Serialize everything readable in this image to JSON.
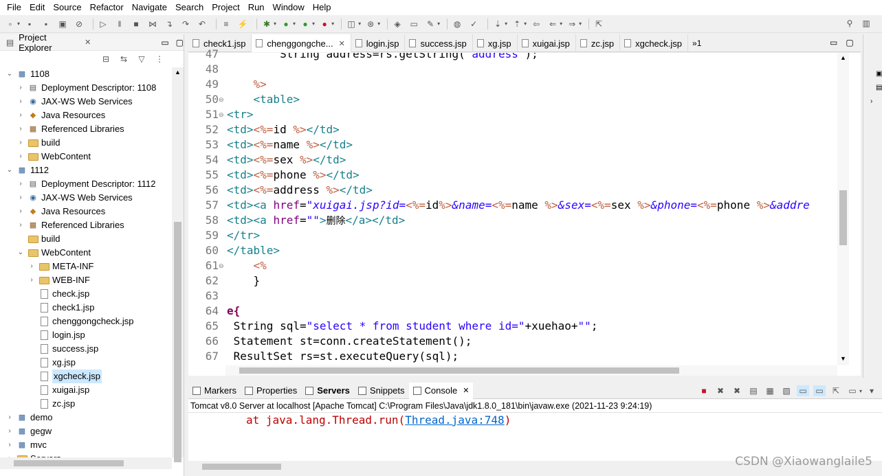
{
  "menu": [
    "File",
    "Edit",
    "Source",
    "Refactor",
    "Navigate",
    "Search",
    "Project",
    "Run",
    "Window",
    "Help"
  ],
  "explorer": {
    "title": "Project Explorer",
    "close": "✕",
    "tree": [
      {
        "label": "1108",
        "twisty": "⌄",
        "icon": "project-icon"
      },
      {
        "label": "Deployment Descriptor: 1108",
        "twisty": "›",
        "icon": "descriptor-icon"
      },
      {
        "label": "JAX-WS Web Services",
        "twisty": "›",
        "icon": "webservice-icon"
      },
      {
        "label": "Java Resources",
        "twisty": "›",
        "icon": "java-resources-icon"
      },
      {
        "label": "Referenced Libraries",
        "twisty": "›",
        "icon": "library-icon"
      },
      {
        "label": "build",
        "twisty": "›",
        "icon": "folder-icon"
      },
      {
        "label": "WebContent",
        "twisty": "›",
        "icon": "folder-icon"
      },
      {
        "label": "1112",
        "twisty": "⌄",
        "icon": "project-icon"
      },
      {
        "label": "Deployment Descriptor: 1112",
        "twisty": "›",
        "icon": "descriptor-icon"
      },
      {
        "label": "JAX-WS Web Services",
        "twisty": "›",
        "icon": "webservice-icon"
      },
      {
        "label": "Java Resources",
        "twisty": "›",
        "icon": "java-resources-icon"
      },
      {
        "label": "Referenced Libraries",
        "twisty": "›",
        "icon": "library-icon"
      },
      {
        "label": "build",
        "twisty": "",
        "icon": "folder-icon"
      },
      {
        "label": "WebContent",
        "twisty": "⌄",
        "icon": "folder-icon"
      },
      {
        "label": "META-INF",
        "twisty": "›",
        "icon": "folder-icon"
      },
      {
        "label": "WEB-INF",
        "twisty": "›",
        "icon": "folder-icon"
      },
      {
        "label": "check.jsp",
        "twisty": "",
        "icon": "file-icon"
      },
      {
        "label": "check1.jsp",
        "twisty": "",
        "icon": "file-icon"
      },
      {
        "label": "chenggongcheck.jsp",
        "twisty": "",
        "icon": "file-icon"
      },
      {
        "label": "login.jsp",
        "twisty": "",
        "icon": "file-icon"
      },
      {
        "label": "success.jsp",
        "twisty": "",
        "icon": "file-icon"
      },
      {
        "label": "xg.jsp",
        "twisty": "",
        "icon": "file-icon"
      },
      {
        "label": "xgcheck.jsp",
        "twisty": "",
        "icon": "file-icon",
        "selected": true
      },
      {
        "label": "xuigai.jsp",
        "twisty": "",
        "icon": "file-icon"
      },
      {
        "label": "zc.jsp",
        "twisty": "",
        "icon": "file-icon"
      },
      {
        "label": "demo",
        "twisty": "›",
        "icon": "project-icon"
      },
      {
        "label": "gegw",
        "twisty": "›",
        "icon": "project-icon"
      },
      {
        "label": "mvc",
        "twisty": "›",
        "icon": "project-icon"
      },
      {
        "label": "Servers",
        "twisty": "›",
        "icon": "folder-icon"
      }
    ]
  },
  "editor": {
    "tabs": [
      {
        "label": "check1.jsp",
        "active": false
      },
      {
        "label": "chenggongche...",
        "active": true,
        "close": "✕"
      },
      {
        "label": "login.jsp",
        "active": false
      },
      {
        "label": "success.jsp",
        "active": false
      },
      {
        "label": "xg.jsp",
        "active": false
      },
      {
        "label": "xuigai.jsp",
        "active": false
      },
      {
        "label": "zc.jsp",
        "active": false
      },
      {
        "label": "xgcheck.jsp",
        "active": false
      }
    ],
    "overflow": "»1",
    "line_numbers": [
      "47",
      "48",
      "49",
      "50",
      "51",
      "52",
      "53",
      "54",
      "55",
      "56",
      "57",
      "58",
      "59",
      "60",
      "61",
      "62",
      "63",
      "64",
      "65",
      "66",
      "67"
    ],
    "fold_markers": {
      "50": "⊖",
      "51": "⊖",
      "61": "⊖"
    },
    "lines": {
      "l47_a": "        String address=rs.getString(",
      "l47_b": "\"address\"",
      "l47_c": ");",
      "l49": "    %>",
      "l50": "    <table>",
      "l51": "<tr>",
      "l52_a": "<td>",
      "l52_b": "<%=",
      "l52_c": "id ",
      "l52_d": "%>",
      "l52_e": "</td>",
      "l53_c": "name ",
      "l54_c": "sex ",
      "l55_c": "phone ",
      "l56_c": "address ",
      "l57_a": "<td><a ",
      "l57_b": "href",
      "l57_c": "=",
      "l57_d": "\"xuigai.jsp?id=",
      "l57_e": "<%=",
      "l57_f": "id",
      "l57_g": "%>",
      "l57_h": "&name=",
      "l57_i": "<%=",
      "l57_j": "name ",
      "l57_k": "%>",
      "l57_l": "&sex=",
      "l57_m": "<%=",
      "l57_n": "sex ",
      "l57_o": "%>",
      "l57_p": "&phone=",
      "l57_q": "<%=",
      "l57_r": "phone ",
      "l57_s": "%>",
      "l57_t": "&addre",
      "l58_a": "<td><a ",
      "l58_b": "href",
      "l58_c": "=",
      "l58_d": "\"\"",
      "l58_e": ">",
      "l58_f": "删除",
      "l58_g": "</a></td>",
      "l59": "</tr>",
      "l60": "</table>",
      "l61": "    <%",
      "l62": "    }",
      "l64": "e{",
      "l65_a": " String sql=",
      "l65_b": "\"select * from student where id=\"",
      "l65_c": "+xuehao+",
      "l65_d": "\"\"",
      "l65_e": ";",
      "l66": " Statement st=conn.createStatement();",
      "l67": " ResultSet rs=st.executeQuery(sql);"
    }
  },
  "console": {
    "tabs": [
      {
        "label": "Markers",
        "bold": false
      },
      {
        "label": "Properties",
        "bold": false
      },
      {
        "label": "Servers",
        "bold": true
      },
      {
        "label": "Snippets",
        "bold": false
      },
      {
        "label": "Console",
        "bold": false,
        "active": true,
        "close": "✕"
      }
    ],
    "status": "Tomcat v8.0 Server at localhost [Apache Tomcat] C:\\Program Files\\Java\\jdk1.8.0_181\\bin\\javaw.exe  (2021-11-23 9:24:19)",
    "line_prefix": "at java.lang.Thread.run(",
    "line_link": "Thread.java:748",
    "line_suffix": ")"
  },
  "watermark": "CSDN @Xiaowanglaile5",
  "colors": {
    "selected_bg": "#cce8ff",
    "error_red": "#c00000",
    "tag": "#17808c",
    "jsp_delim": "#bf5f3f",
    "string": "#2a00ff",
    "attr": "#7f007f"
  }
}
